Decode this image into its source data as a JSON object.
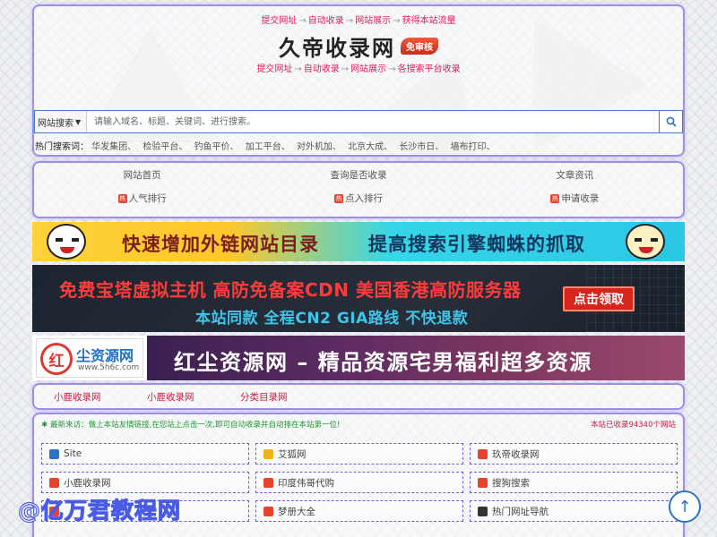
{
  "header": {
    "tagline_top": [
      "提交网址",
      "自动收录",
      "网站展示",
      "获得本站流量"
    ],
    "logo_text": "久帝收录网",
    "logo_badge": "免审核",
    "tagline_bottom": [
      "提交网址",
      "自动收录",
      "网站展示",
      "各搜索平台收录"
    ],
    "arrow": "→"
  },
  "search": {
    "select_value": "网站搜索",
    "placeholder": "请输入域名、标题、关键词、进行搜索。",
    "button_icon": "search-icon"
  },
  "hot": {
    "label": "热门搜索词：",
    "keywords": [
      "华发集团、",
      "检验平台、",
      "钓鱼平价、",
      "加工平台、",
      "对外机加、",
      "北京大成、",
      "长沙市日、",
      "墙布打印、"
    ]
  },
  "nav": {
    "items": [
      "网站首页",
      "查询是否收录",
      "文章资讯",
      "人气排行",
      "点入排行",
      "申请收录"
    ]
  },
  "banners": {
    "b1_left": "快速增加外链网站目录",
    "b1_right": "提高搜索引擎蜘蛛的抓取",
    "b2_main": "免费宝塔虚拟主机 高防免备案CDN 美国香港高防服务器",
    "b2_sub": "本站同款 全程CN2 GIA路线 不快退款",
    "b2_cta": "点击领取",
    "b3_logo_char": "红",
    "b3_logo_name": "尘资源网",
    "b3_logo_url": "www.5h6c.com",
    "b3_main": "红尘资源网 – 精品资源宅男福利超多资源"
  },
  "subnav": {
    "items": [
      "小鹿收录网",
      "小鹿收录网",
      "分类目录网"
    ]
  },
  "listing": {
    "notice_left": "最新来访：做上本站友情链接,在您站上点击一次,即可自动收录并自动排在本站第一位!",
    "notice_right": "本站已收录94340个网站",
    "links": [
      {
        "label": "Site",
        "icon": "camera-icon",
        "color": "#2d72c9"
      },
      {
        "label": "艾狐网",
        "icon": "fox-icon",
        "color": "#f2b21b"
      },
      {
        "label": "玖帝收录网",
        "icon": "site-icon",
        "color": "#e8432c"
      },
      {
        "label": "小鹿收录网",
        "icon": "site-icon",
        "color": "#e8432c"
      },
      {
        "label": "印度伟哥代购",
        "icon": "site-icon",
        "color": "#e8432c"
      },
      {
        "label": "搜狗搜索",
        "icon": "site-icon",
        "color": "#e8432c"
      },
      {
        "label": "",
        "icon": "site-icon",
        "color": "#e8432c"
      },
      {
        "label": "梦册大全",
        "icon": "site-icon",
        "color": "#e8432c"
      },
      {
        "label": "热门网址导航",
        "icon": "site-icon",
        "color": "#333333"
      }
    ]
  },
  "watermark": "@亿万君教程网",
  "scroll_top_icon": "arrow-up-icon"
}
